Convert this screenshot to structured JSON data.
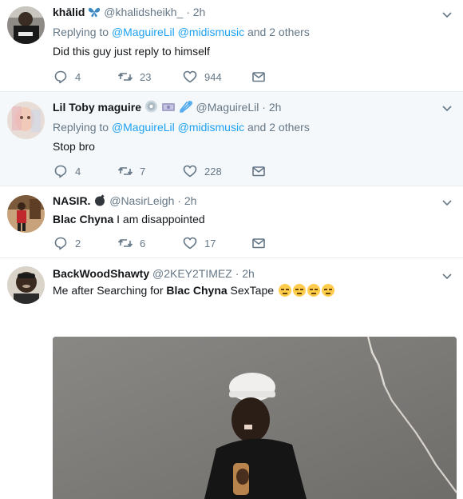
{
  "tweets": [
    {
      "fullname": "khālid",
      "handle": "@khalidsheikh_",
      "time": "2h",
      "replying_label": "Replying to",
      "mentions": [
        "@MaguireLil",
        "@midismusic"
      ],
      "others": "and 2 others",
      "text": "Did this guy just reply to himself",
      "replies": "4",
      "retweets": "23",
      "likes": "944",
      "badge_icon": "butterfly-emoji"
    },
    {
      "fullname": "Lil Toby maguire",
      "handle": "@MaguireLil",
      "time": "2h",
      "replying_label": "Replying to",
      "mentions": [
        "@MaguireLil",
        "@midismusic"
      ],
      "others": "and 2 others",
      "text": "Stop bro",
      "replies": "4",
      "retweets": "7",
      "likes": "228",
      "badge_icons": [
        "cd-emoji",
        "money-emoji",
        "comet-emoji"
      ]
    },
    {
      "fullname": "NASIR.",
      "handle": "@NasirLeigh",
      "time": "2h",
      "text_bold": "Blac Chyna",
      "text_rest": " I am disappointed",
      "replies": "2",
      "retweets": "6",
      "likes": "17",
      "badge_icon": "bomb-emoji"
    },
    {
      "fullname": "BackWoodShawty",
      "handle": "@2KEY2TIMEZ",
      "time": "2h",
      "text_pre": "Me after Searching for ",
      "text_bold": "Blac Chyna",
      "text_post": " SexTape",
      "emoji_icon": "expressionless-face-emoji",
      "media_alt": "video-still"
    }
  ],
  "colors": {
    "accent": "#1da1f2",
    "muted": "#657786",
    "highlight_bg": "#f5f8fa",
    "border": "#e6ecf0"
  }
}
